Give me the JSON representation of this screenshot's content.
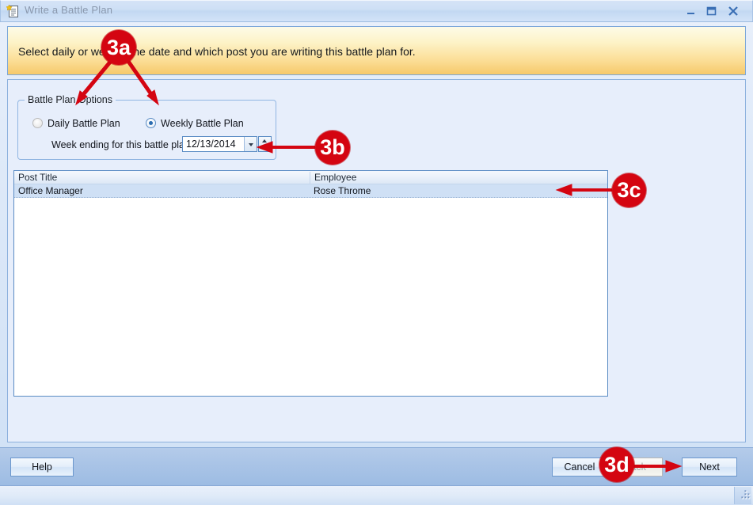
{
  "window": {
    "title": "Write a Battle Plan",
    "icon": "document-star-icon",
    "controls": {
      "minimize": "–",
      "maximize": "❐",
      "close": "✕"
    }
  },
  "banner": {
    "text": "Select daily or weekly, the date and which post you are writing this battle plan for."
  },
  "group": {
    "title": "Battle Plan Options",
    "options": [
      {
        "label": "Daily Battle Plan",
        "selected": false
      },
      {
        "label": "Weekly Battle Plan",
        "selected": true
      }
    ],
    "date_label": "Week ending for this battle plan:",
    "date_value": "12/13/2014"
  },
  "list": {
    "columns": [
      "Post Title",
      "Employee"
    ],
    "rows": [
      {
        "post_title": "Office Manager",
        "employee": "Rose Throme",
        "selected": true
      }
    ]
  },
  "footer": {
    "help": "Help",
    "cancel": "Cancel",
    "back": "Back",
    "next": "Next"
  },
  "annotations": [
    {
      "id": "3a",
      "label": "3a"
    },
    {
      "id": "3b",
      "label": "3b"
    },
    {
      "id": "3c",
      "label": "3c"
    },
    {
      "id": "3d",
      "label": "3d"
    }
  ],
  "colors": {
    "annotation_red": "#d40511",
    "banner_top": "#fdfbe8",
    "banner_bottom": "#f6c96b",
    "client_bg": "#e7eefb",
    "selection_blue": "#cfe0f5"
  }
}
